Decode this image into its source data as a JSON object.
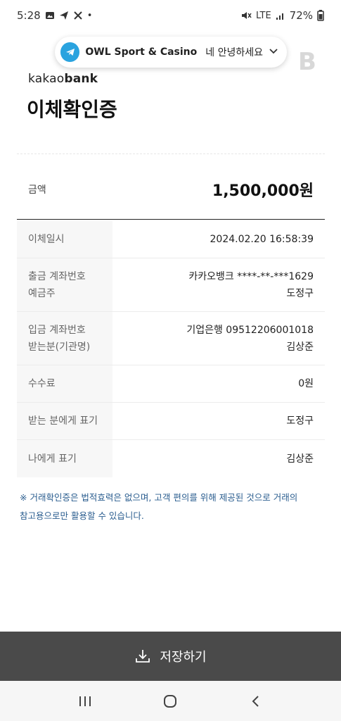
{
  "status": {
    "time": "5:28",
    "lte": "LTE",
    "battery": "72%"
  },
  "notification": {
    "title": "OWL Sport & Casino",
    "message": "네 안녕하세요"
  },
  "header": {
    "brand_prefix": "kakao",
    "brand_suffix": "bank",
    "title": "이체확인증"
  },
  "amount": {
    "label": "금액",
    "value": "1,500,000원"
  },
  "rows": [
    {
      "label": "이체일시",
      "value": "2024.02.20 16:58:39"
    },
    {
      "label": "출금 계좌번호",
      "label2": "예금주",
      "value": "카카오뱅크 ****-**-***1629",
      "value2": "도정구"
    },
    {
      "label": "입금 계좌번호",
      "label2": "받는분(기관명)",
      "value": "기업은행 09512206001018",
      "value2": "김상준"
    },
    {
      "label": "수수료",
      "value": "0원"
    },
    {
      "label": "받는 분에게 표기",
      "value": "도정구"
    },
    {
      "label": "나에게 표기",
      "value": "김상준"
    }
  ],
  "notice": {
    "line1": "※ 거래확인증은 법적효력은 없으며, 고객 편의를 위해 제공된 것으로 거래의",
    "line2": "참고용으로만 활용할 수 있습니다."
  },
  "save": {
    "label": "저장하기"
  },
  "icons": {
    "telegram": "telegram-icon",
    "download": "download-icon",
    "recents": "recents-icon",
    "home": "home-icon",
    "back": "back-icon"
  },
  "colors": {
    "telegram": "#2aa3df",
    "save_bar": "#4a4a4a",
    "notice": "#2a5d8f"
  }
}
